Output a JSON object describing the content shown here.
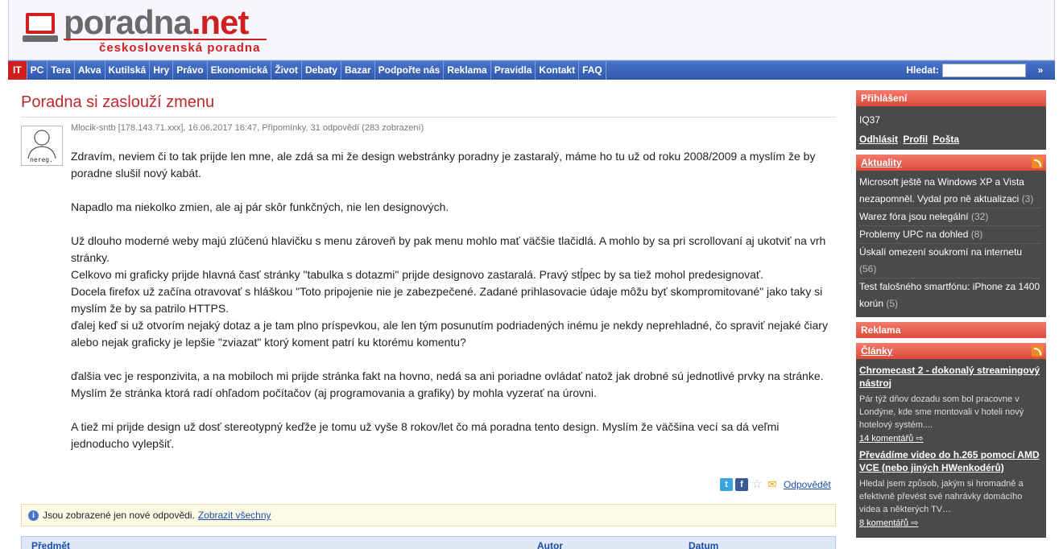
{
  "logo": {
    "name_main": "poradna",
    "name_dot": ".",
    "name_tld": "net",
    "tagline": "československá poradna"
  },
  "nav": {
    "items": [
      "IT",
      "PC",
      "Tera",
      "Akva",
      "Kutilská",
      "Hry",
      "Právo",
      "Ekonomická",
      "Život",
      "Debaty",
      "Bazar",
      "Podpořte nás",
      "Reklama",
      "Pravidla",
      "Kontakt",
      "FAQ"
    ],
    "search_label": "Hledat:",
    "search_go": "»"
  },
  "post": {
    "title": "Poradna si zaslouží zmenu",
    "avatar_caption": "nereg.",
    "meta": "Mlocik-sntb [178.143.71.xxx], 16.06.2017 16:47, Připomínky, 31 odpovědí (283 zobrazení)",
    "paragraphs": [
      "Zdravím, neviem či to tak prijde len mne, ale zdá sa mi že design webstránky poradny je zastaralý, máme ho tu už od roku 2008/2009 a myslím že by poradne slušil nový kabát.",
      "",
      "Napadlo ma niekolko zmien, ale aj pár skôr funkčných, nie len designových.",
      "",
      "Už dlouho moderné weby majú zlúčenú hlavičku s menu zároveň by pak menu mohlo mať väčšie tlačidlá. A mohlo by sa pri scrollovaní aj ukotviť na vrh stránky.",
      "Celkovo mi graficky prijde hlavná časť stránky \"tabulka s dotazmi\" prijde designovo zastaralá. Pravý stĺpec by sa tiež mohol predesignovať.",
      "Docela firefox už začína otravovať s hláškou \"Toto pripojenie nie je zabezpečené. Zadané prihlasovacie údaje môžu byť skompromitované\" jako taky si myslím že by sa patrilo HTTPS.",
      "ďalej keď si už otvorím nejaký dotaz a je tam plno príspevkou, ale len tým posunutím podriadených inému je nekdy neprehladné, čo spraviť nejaké čiary alebo nejak graficky je lepšie \"zviazat\" ktorý koment patrí ku ktorému komentu?",
      "",
      "ďalšia vec je responzivita, a na mobiloch mi prijde stránka fakt na hovno, nedá sa ani poriadne ovládať natož jak drobné sú jednotlivé prvky na stránke.",
      "Myslím že stránka ktorá radí ohľadom počítačov (aj programovania a grafiky) by mohla vyzerať na úrovni.",
      "",
      "A tiež mi prijde design už dosť stereotypný keďže je tomu už vyše 8 rokov/let čo má poradna tento design. Myslím že väčšina vecí sa dá veľmi jednoducho vylepšiť."
    ],
    "reply_label": "Odpovědět"
  },
  "notice": {
    "text": "Jsou zobrazené jen nové odpovědi.",
    "link": "Zobrazit všechny"
  },
  "table_head": {
    "subject": "Předmět",
    "author": "Autor",
    "date": "Datum"
  },
  "sidebar": {
    "login": {
      "title": "Přihlášení",
      "user": "IQ37",
      "links": [
        "Odhlásit",
        "Profil",
        "Pošta"
      ]
    },
    "news": {
      "title": "Aktuality",
      "items": [
        {
          "text": "Microsoft ještě na Windows XP a Vista nezapomněl. Vydal pro ně aktualizaci",
          "count": "(3)"
        },
        {
          "text": "Warez fóra jsou nelegální",
          "count": "(32)"
        },
        {
          "text": "Problemy UPC na dohled",
          "count": "(8)"
        },
        {
          "text": "Úskalí omezení soukromí na internetu",
          "count": "(56)"
        },
        {
          "text": "Test falošného smartfónu: iPhone za 1400 korún",
          "count": "(5)"
        }
      ]
    },
    "ads": {
      "title": "Reklama"
    },
    "articles": {
      "title": "Články",
      "items": [
        {
          "title": "Chromecast 2 - dokonalý streamingový nástroj",
          "desc": "Pár týž dňov dozadu som bol pracovne v Londýne, kde sme montovali v hoteli nový hotelový systém....",
          "comments": "14 komentářů"
        },
        {
          "title": "Převádíme video do h.265 pomocí AMD VCE (nebo jiných HWenkodérů)",
          "desc": "Hledal jsem způsob, jakým si hromadně a efektivně převést své nahrávky domácího videa a některých TV…",
          "comments": "8 komentářů"
        }
      ]
    }
  }
}
